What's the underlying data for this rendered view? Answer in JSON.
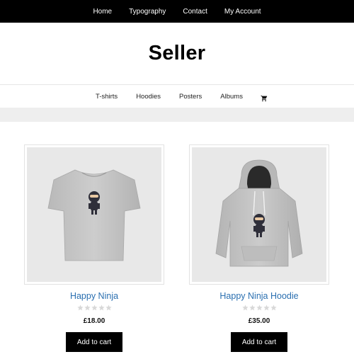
{
  "top_nav": {
    "items": [
      "Home",
      "Typography",
      "Contact",
      "My Account"
    ]
  },
  "site": {
    "title": "Seller"
  },
  "main_nav": {
    "items": [
      "T-shirts",
      "Hoodies",
      "Posters",
      "Albums"
    ],
    "cart_icon": "shopping-cart-icon"
  },
  "products": [
    {
      "title": "Happy Ninja",
      "price": "£18.00",
      "rating": 0,
      "button_label": "Add to cart",
      "image_icon": "tshirt-image"
    },
    {
      "title": "Happy Ninja Hoodie",
      "price": "£35.00",
      "rating": 0,
      "button_label": "Add to cart",
      "image_icon": "hoodie-image"
    }
  ],
  "colors": {
    "top_bar": "#000000",
    "link": "#2a6fb0",
    "button": "#000000",
    "band": "#eeeeee",
    "star_empty": "#d8d8d8"
  }
}
